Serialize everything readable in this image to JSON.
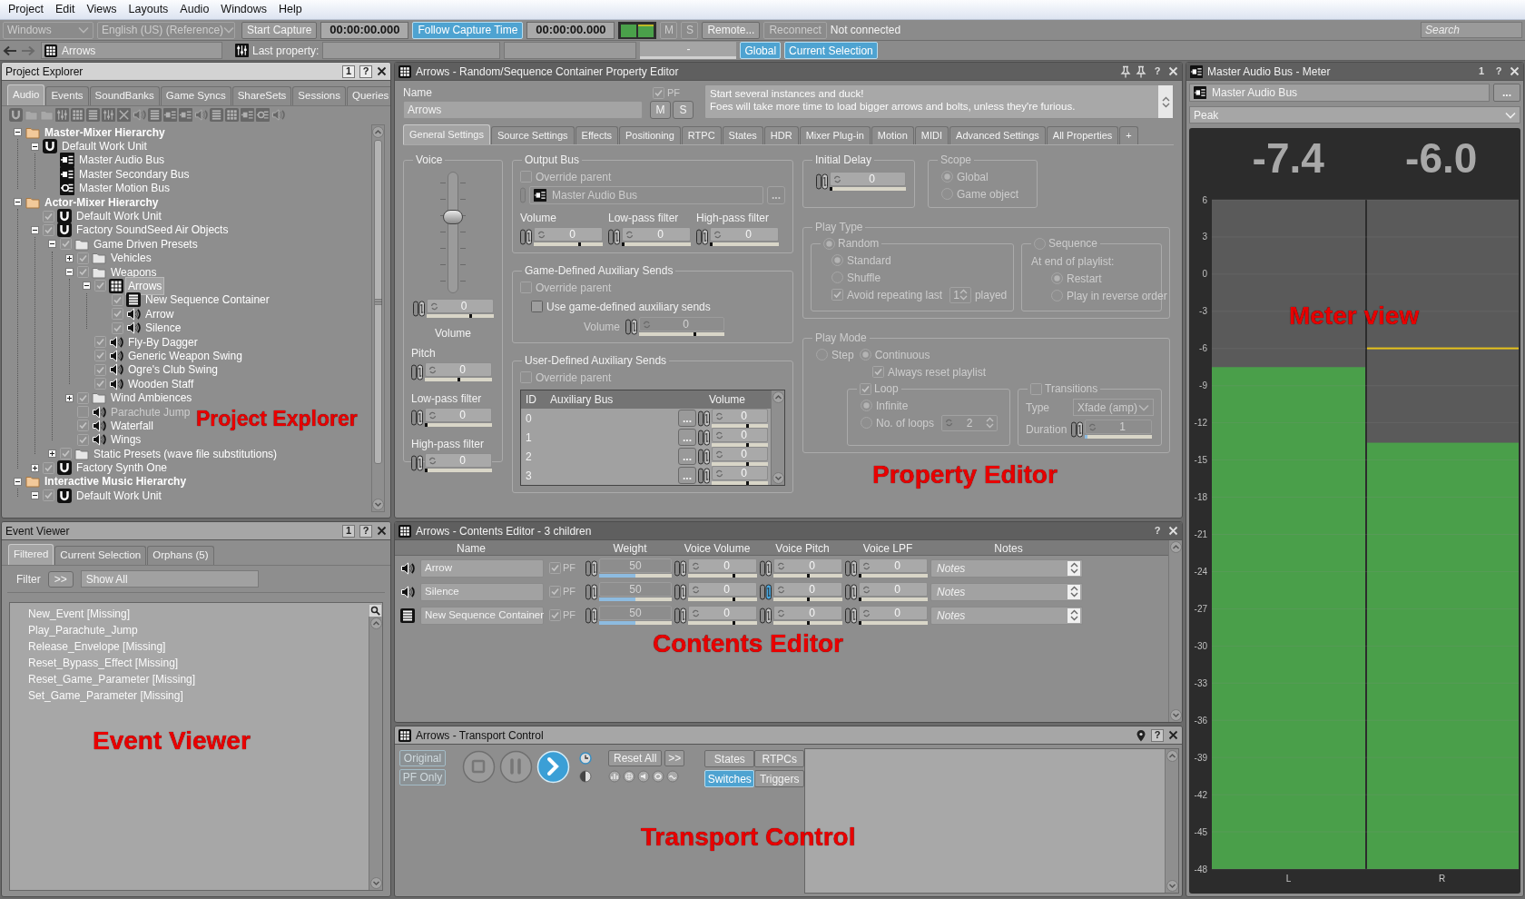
{
  "menu_bar": [
    "Project",
    "Edit",
    "Views",
    "Layouts",
    "Audio",
    "Windows",
    "Help"
  ],
  "toolbar": {
    "platform": {
      "value": "Windows",
      "disabled": true
    },
    "language": {
      "value": "English (US) (Reference)",
      "disabled": true
    },
    "start_capture": "Start Capture",
    "capture_time": "00:00:00.000",
    "follow_capture": {
      "label": "Follow Capture Time",
      "on": true
    },
    "cursor_time": "00:00:00.000",
    "mute": {
      "label": "M",
      "disabled": true
    },
    "solo": {
      "label": "S",
      "disabled": true
    },
    "remote": {
      "label": "Remote...",
      "disabled": false
    },
    "reconnect": {
      "label": "Reconnect",
      "disabled": true
    },
    "connection_status": "Not connected",
    "search": {
      "placeholder": "Search"
    }
  },
  "toolbar_2": {
    "object": "Arrows",
    "last_property_label": "Last property:",
    "value": "-",
    "global": {
      "label": "Global",
      "on": true
    },
    "current_selection": {
      "label": "Current Selection",
      "on": true
    }
  },
  "project_explorer": {
    "title": "Project Explorer",
    "number": "1",
    "help": "?",
    "callout": "Project Explorer",
    "tabs": [
      {
        "label": "Audio",
        "selected": true
      },
      {
        "label": "Events",
        "selected": false
      },
      {
        "label": "SoundBanks",
        "selected": false
      },
      {
        "label": "Game Syncs",
        "selected": false
      },
      {
        "label": "ShareSets",
        "selected": false
      },
      {
        "label": "Sessions",
        "selected": false
      },
      {
        "label": "Queries",
        "selected": false
      }
    ],
    "tree": [
      {
        "label": "Master-Mixer Hierarchy",
        "kind": "hierarchy",
        "expanded": true,
        "selected": false,
        "children": [
          {
            "label": "Default Work Unit",
            "kind": "work_unit",
            "expanded": true,
            "selected": false,
            "children": [
              {
                "label": "Master Audio Bus",
                "kind": "bus",
                "selected": false
              },
              {
                "label": "Master Secondary Bus",
                "kind": "bus",
                "selected": false
              },
              {
                "label": "Master Motion Bus",
                "kind": "motion_bus",
                "selected": false
              }
            ]
          }
        ]
      },
      {
        "label": "Actor-Mixer Hierarchy",
        "kind": "hierarchy",
        "expanded": true,
        "selected": false,
        "children": [
          {
            "label": "Default Work Unit",
            "kind": "work_unit",
            "checked": true,
            "selected": false
          },
          {
            "label": "Factory SoundSeed Air Objects",
            "kind": "work_unit",
            "expanded": true,
            "checked": true,
            "selected": false,
            "children": [
              {
                "label": "Game Driven Presets",
                "kind": "folder",
                "expanded": true,
                "checked": true,
                "selected": false,
                "children": [
                  {
                    "label": "Vehicles",
                    "kind": "folder",
                    "expanded": false,
                    "checked": true,
                    "selected": false
                  },
                  {
                    "label": "Weapons",
                    "kind": "folder",
                    "expanded": true,
                    "checked": true,
                    "selected": false,
                    "children": [
                      {
                        "label": "Arrows",
                        "kind": "random_container",
                        "expanded": true,
                        "checked": true,
                        "selected": true,
                        "children": [
                          {
                            "label": "New Sequence Container",
                            "kind": "sequence_container",
                            "checked": true,
                            "selected": false
                          },
                          {
                            "label": "Arrow",
                            "kind": "sound",
                            "checked": true,
                            "selected": false
                          },
                          {
                            "label": "Silence",
                            "kind": "sound",
                            "checked": true,
                            "selected": false
                          }
                        ]
                      },
                      {
                        "label": "Fly-By Dagger",
                        "kind": "sound",
                        "checked": true,
                        "selected": false
                      },
                      {
                        "label": "Generic Weapon Swing",
                        "kind": "sound",
                        "checked": true,
                        "selected": false
                      },
                      {
                        "label": "Ogre's Club Swing",
                        "kind": "sound",
                        "checked": true,
                        "selected": false
                      },
                      {
                        "label": "Wooden Staff",
                        "kind": "sound",
                        "checked": true,
                        "selected": false
                      }
                    ]
                  },
                  {
                    "label": "Wind Ambiences",
                    "kind": "folder",
                    "expanded": false,
                    "checked": true,
                    "selected": false
                  },
                  {
                    "label": "Parachute Jump",
                    "kind": "sound",
                    "checked": false,
                    "selected": false
                  },
                  {
                    "label": "Waterfall",
                    "kind": "sound",
                    "checked": true,
                    "selected": false
                  },
                  {
                    "label": "Wings",
                    "kind": "sound",
                    "checked": true,
                    "selected": false
                  }
                ]
              },
              {
                "label": "Static Presets (wave file substitutions)",
                "kind": "folder",
                "expanded": false,
                "checked": true,
                "selected": false
              }
            ]
          },
          {
            "label": "Factory Synth One",
            "kind": "work_unit",
            "expanded": false,
            "checked": true,
            "selected": false
          }
        ]
      },
      {
        "label": "Interactive Music Hierarchy",
        "kind": "hierarchy",
        "expanded": true,
        "selected": false,
        "children": [
          {
            "label": "Default Work Unit",
            "kind": "work_unit",
            "expanded": true,
            "checked": true,
            "selected": false
          }
        ]
      }
    ]
  },
  "event_viewer": {
    "title": "Event Viewer",
    "number": "1",
    "help": "?",
    "callout": "Event Viewer",
    "tabs": [
      {
        "label": "Filtered",
        "selected": true
      },
      {
        "label": "Current Selection",
        "selected": false
      },
      {
        "label": "Orphans (5)",
        "selected": false
      }
    ],
    "filter_label": "Filter",
    "filter_button": ">>",
    "filter_value": "Show All",
    "events": [
      "New_Event [Missing]",
      "Play_Parachute_Jump",
      "Release_Envelope [Missing]",
      "Reset_Bypass_Effect [Missing]",
      "Reset_Game_Parameter [Missing]",
      "Set_Game_Parameter [Missing]"
    ]
  },
  "property_editor": {
    "title": "Arrows - Random/Sequence Container Property Editor",
    "help": "?",
    "callout": "Property Editor",
    "name_label": "Name",
    "name": "Arrows",
    "pf": {
      "label": "PF",
      "checked": true
    },
    "mute": "M",
    "solo": "S",
    "notes": [
      "Start several instances and duck!",
      "Foes will take more time to load bigger arrows and bolts, unless they're furious."
    ],
    "tabs": [
      {
        "label": "General Settings",
        "selected": true
      },
      {
        "label": "Source Settings",
        "selected": false
      },
      {
        "label": "Effects",
        "selected": false
      },
      {
        "label": "Positioning",
        "selected": false
      },
      {
        "label": "RTPC",
        "selected": false
      },
      {
        "label": "States",
        "selected": false
      },
      {
        "label": "HDR",
        "selected": false
      },
      {
        "label": "Mixer Plug-in",
        "selected": false
      },
      {
        "label": "Motion",
        "selected": false
      },
      {
        "label": "MIDI",
        "selected": false
      },
      {
        "label": "Advanced Settings",
        "selected": false
      },
      {
        "label": "All Properties",
        "selected": false
      },
      {
        "label": "+",
        "selected": false
      }
    ],
    "voice": {
      "title": "Voice",
      "fader": {
        "level": 0.64
      },
      "volume": {
        "value": "0",
        "level": 0.67
      },
      "volume_label": "Volume",
      "pitch_label": "Pitch",
      "pitch": {
        "value": "0",
        "level": 0.5
      },
      "lpf_label": "Low-pass filter",
      "lpf": {
        "value": "0",
        "level": 0
      },
      "hpf_label": "High-pass filter",
      "hpf": {
        "value": "0",
        "level": 0
      }
    },
    "output_bus": {
      "title": "Output Bus",
      "override": {
        "label": "Override parent",
        "checked": false,
        "disabled": true
      },
      "bus": {
        "value": "Master Audio Bus",
        "disabled": true
      },
      "browse": "...",
      "fields": [
        {
          "label": "Volume",
          "value": "0",
          "level": 0.67
        },
        {
          "label": "Low-pass filter",
          "value": "0",
          "level": 0
        },
        {
          "label": "High-pass filter",
          "value": "0",
          "level": 0
        }
      ]
    },
    "game_aux": {
      "title": "Game-Defined Auxiliary Sends",
      "override": {
        "label": "Override parent",
        "checked": false,
        "disabled": true
      },
      "use_game": {
        "label": "Use game-defined auxiliary sends",
        "checked": false,
        "disabled": false
      },
      "volume": {
        "label": "Volume",
        "value": "0",
        "level": 0.66,
        "disabled": true
      }
    },
    "user_aux": {
      "title": "User-Defined Auxiliary Sends",
      "override": {
        "label": "Override parent",
        "checked": false,
        "disabled": true
      },
      "columns": [
        "ID",
        "Auxiliary Bus",
        "Volume"
      ],
      "rows": [
        {
          "id": "0",
          "browse": "...",
          "volume": {
            "value": "0",
            "level": 0.64
          }
        },
        {
          "id": "1",
          "browse": "...",
          "volume": {
            "value": "0",
            "level": 0.64
          }
        },
        {
          "id": "2",
          "browse": "...",
          "volume": {
            "value": "0",
            "level": 0.64
          }
        },
        {
          "id": "3",
          "browse": "...",
          "volume": {
            "value": "0",
            "level": 0.64
          }
        }
      ]
    },
    "initial_delay": {
      "title": "Initial Delay",
      "value": "0",
      "level": 0
    },
    "scope": {
      "title": "Scope",
      "disabled": true,
      "options": [
        {
          "label": "Global",
          "selected": true
        },
        {
          "label": "Game object",
          "selected": false
        }
      ]
    },
    "play_type": {
      "title": "Play Type",
      "disabled": true,
      "random": {
        "label": "Random",
        "selected": true,
        "options": [
          {
            "label": "Standard",
            "selected": true
          },
          {
            "label": "Shuffle",
            "selected": false
          }
        ],
        "avoid": {
          "label": "Avoid repeating last",
          "checked": true,
          "value": "1",
          "suffix": "played"
        }
      },
      "sequence": {
        "label": "Sequence",
        "selected": false,
        "end_label": "At end of playlist:",
        "options": [
          {
            "label": "Restart",
            "selected": true
          },
          {
            "label": "Play in reverse order",
            "selected": false
          }
        ]
      }
    },
    "play_mode": {
      "title": "Play Mode",
      "disabled": true,
      "modes": [
        {
          "label": "Step",
          "selected": false
        },
        {
          "label": "Continuous",
          "selected": true
        }
      ],
      "always_reset": {
        "label": "Always reset playlist",
        "checked": true
      },
      "loop": {
        "label": "Loop",
        "checked": true,
        "options": [
          {
            "label": "Infinite",
            "selected": true
          },
          {
            "label": "No. of loops",
            "selected": false
          }
        ],
        "count": "2"
      },
      "transitions": {
        "label": "Transitions",
        "checked": false,
        "type_label": "Type",
        "type": "Xfade (amp)",
        "duration_label": "Duration",
        "duration": {
          "value": "1",
          "level": 0.04
        }
      }
    }
  },
  "contents_editor": {
    "title": "Arrows - Contents Editor - 3 children",
    "help": "?",
    "callout": "Contents Editor",
    "columns": [
      "Name",
      "Weight",
      "Voice Volume",
      "Voice Pitch",
      "Voice LPF",
      "Notes"
    ],
    "rows": [
      {
        "kind": "sound",
        "name": "Arrow",
        "pf": {
          "label": "PF",
          "checked": true
        },
        "weight": {
          "value": "50",
          "level": 0.5,
          "disabled": true
        },
        "volume": {
          "value": "0",
          "level": 0.67
        },
        "pitch": {
          "value": "0",
          "level": 0.5,
          "linked": false
        },
        "lpf": {
          "value": "0",
          "level": 0
        },
        "notes": {
          "placeholder": "Notes"
        }
      },
      {
        "kind": "sound",
        "name": "Silence",
        "pf": {
          "label": "PF",
          "checked": true
        },
        "weight": {
          "value": "50",
          "level": 0.5,
          "disabled": true
        },
        "volume": {
          "value": "0",
          "level": 0.67
        },
        "pitch": {
          "value": "0",
          "level": 0.5,
          "linked": true
        },
        "lpf": {
          "value": "0",
          "level": 0
        },
        "notes": {
          "placeholder": "Notes"
        }
      },
      {
        "kind": "sequence_container",
        "name": "New Sequence Container",
        "pf": {
          "label": "PF",
          "checked": true
        },
        "weight": {
          "value": "50",
          "level": 0.5,
          "disabled": true
        },
        "volume": {
          "value": "0",
          "level": 0.67
        },
        "pitch": {
          "value": "0",
          "level": 0.5,
          "linked": false
        },
        "lpf": {
          "value": "0",
          "level": 0
        },
        "notes": {
          "placeholder": "Notes"
        }
      }
    ]
  },
  "transport": {
    "title": "Arrows - Transport Control",
    "help": "?",
    "callout": "Transport Control",
    "original": {
      "label": "Original",
      "disabled": true
    },
    "pf_only": {
      "label": "PF Only",
      "disabled": true
    },
    "controls": [
      {
        "kind": "stop",
        "active": false
      },
      {
        "kind": "pause",
        "active": false
      },
      {
        "kind": "play",
        "active": true
      }
    ],
    "reset_all": "Reset All",
    "more": ">>",
    "tabs": [
      {
        "label": "States",
        "selected": false
      },
      {
        "label": "RTPCs",
        "selected": false
      },
      {
        "label": "Switches",
        "selected": true
      },
      {
        "label": "Triggers",
        "selected": false
      }
    ]
  },
  "meter": {
    "title": "Master Audio Bus - Meter",
    "number": "1",
    "help": "?",
    "callout": "Meter view",
    "bus": "Master Audio Bus",
    "browse": "...",
    "mode": "Peak",
    "scale": [
      "6",
      "3",
      "0",
      "-3",
      "-6",
      "-9",
      "-12",
      "-15",
      "-18",
      "-21",
      "-24",
      "-27",
      "-30",
      "-33",
      "-36",
      "-39",
      "-42",
      "-45",
      "-48"
    ],
    "channels": [
      {
        "label": "L",
        "reading": "-7.4",
        "level": 0.75
      },
      {
        "label": "R",
        "reading": "-6.0",
        "level": 0.637,
        "peak_hold": {
          "level": 0.778
        }
      }
    ]
  }
}
